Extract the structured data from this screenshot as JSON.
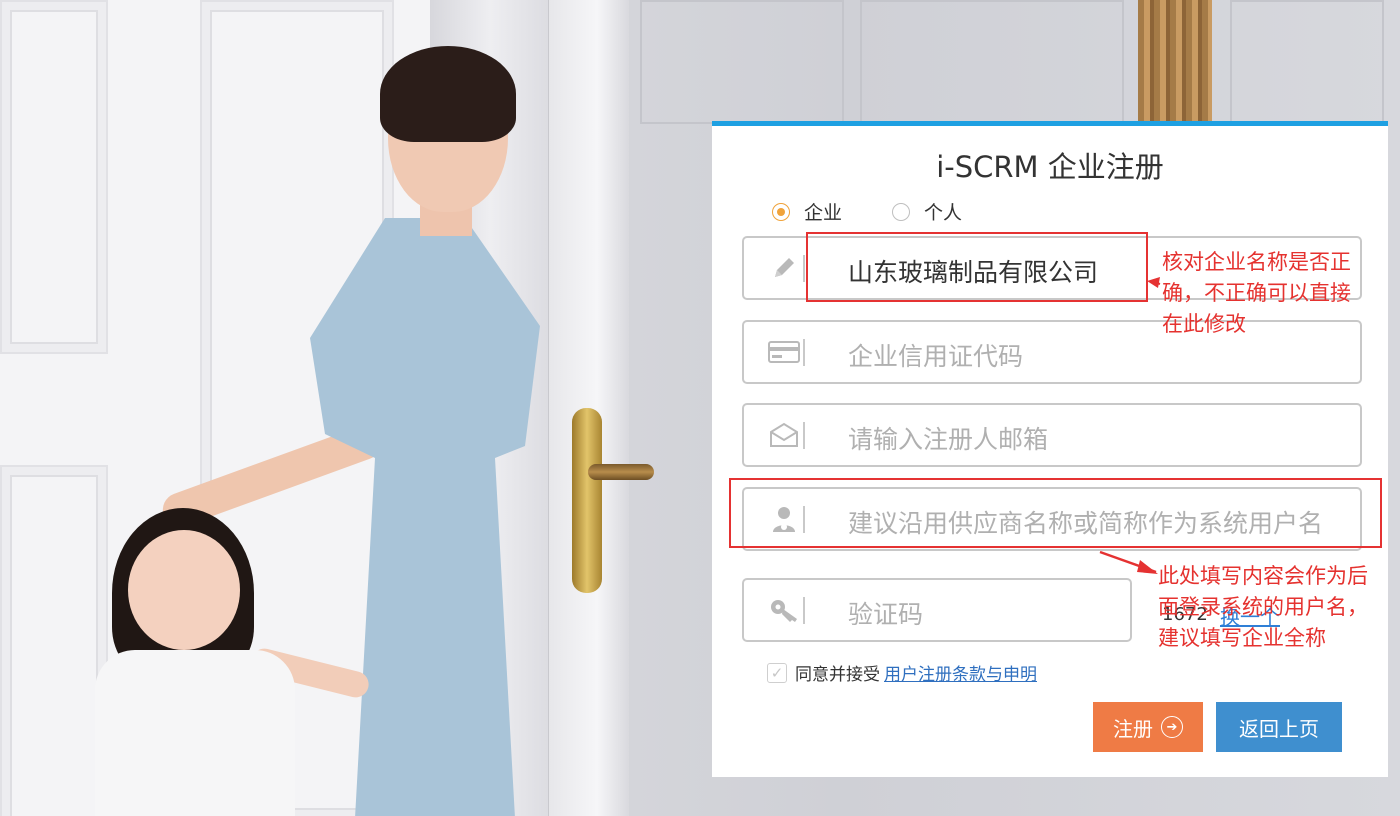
{
  "card": {
    "title": "i-SCRM 企业注册",
    "account_types": [
      {
        "label": "企业",
        "selected": true
      },
      {
        "label": "个人",
        "selected": false
      }
    ],
    "fields": {
      "company_name": {
        "value": "山东玻璃制品有限公司",
        "icon": "pencil-icon"
      },
      "credit_code": {
        "placeholder": "企业信用证代码",
        "icon": "card-icon"
      },
      "email": {
        "placeholder": "请输入注册人邮箱",
        "icon": "envelope-icon"
      },
      "username": {
        "placeholder": "建议沿用供应商名称或简称作为系统用户名",
        "icon": "user-icon"
      },
      "captcha": {
        "placeholder": "验证码",
        "icon": "key-icon"
      }
    },
    "captcha_code": "1672",
    "captcha_refresh": "换一个",
    "agree": {
      "text": "同意并接受",
      "link": "用户注册条款与申明",
      "checked": true
    },
    "buttons": {
      "register": "注册",
      "back": "返回上页"
    },
    "accent_colors": {
      "top_bar": "#1ea0e2",
      "register": "#ef7b45",
      "back": "#3f8fcf",
      "radio": "#f0a33b"
    }
  },
  "annotations": {
    "note_company": [
      "核对企业名称是否正",
      "确，不正确可以直接",
      "在此修改"
    ],
    "note_username": [
      "此处填写内容会作为后",
      "面登录系统的用户名，",
      "建议填写企业全称"
    ],
    "color": "#e53232"
  }
}
